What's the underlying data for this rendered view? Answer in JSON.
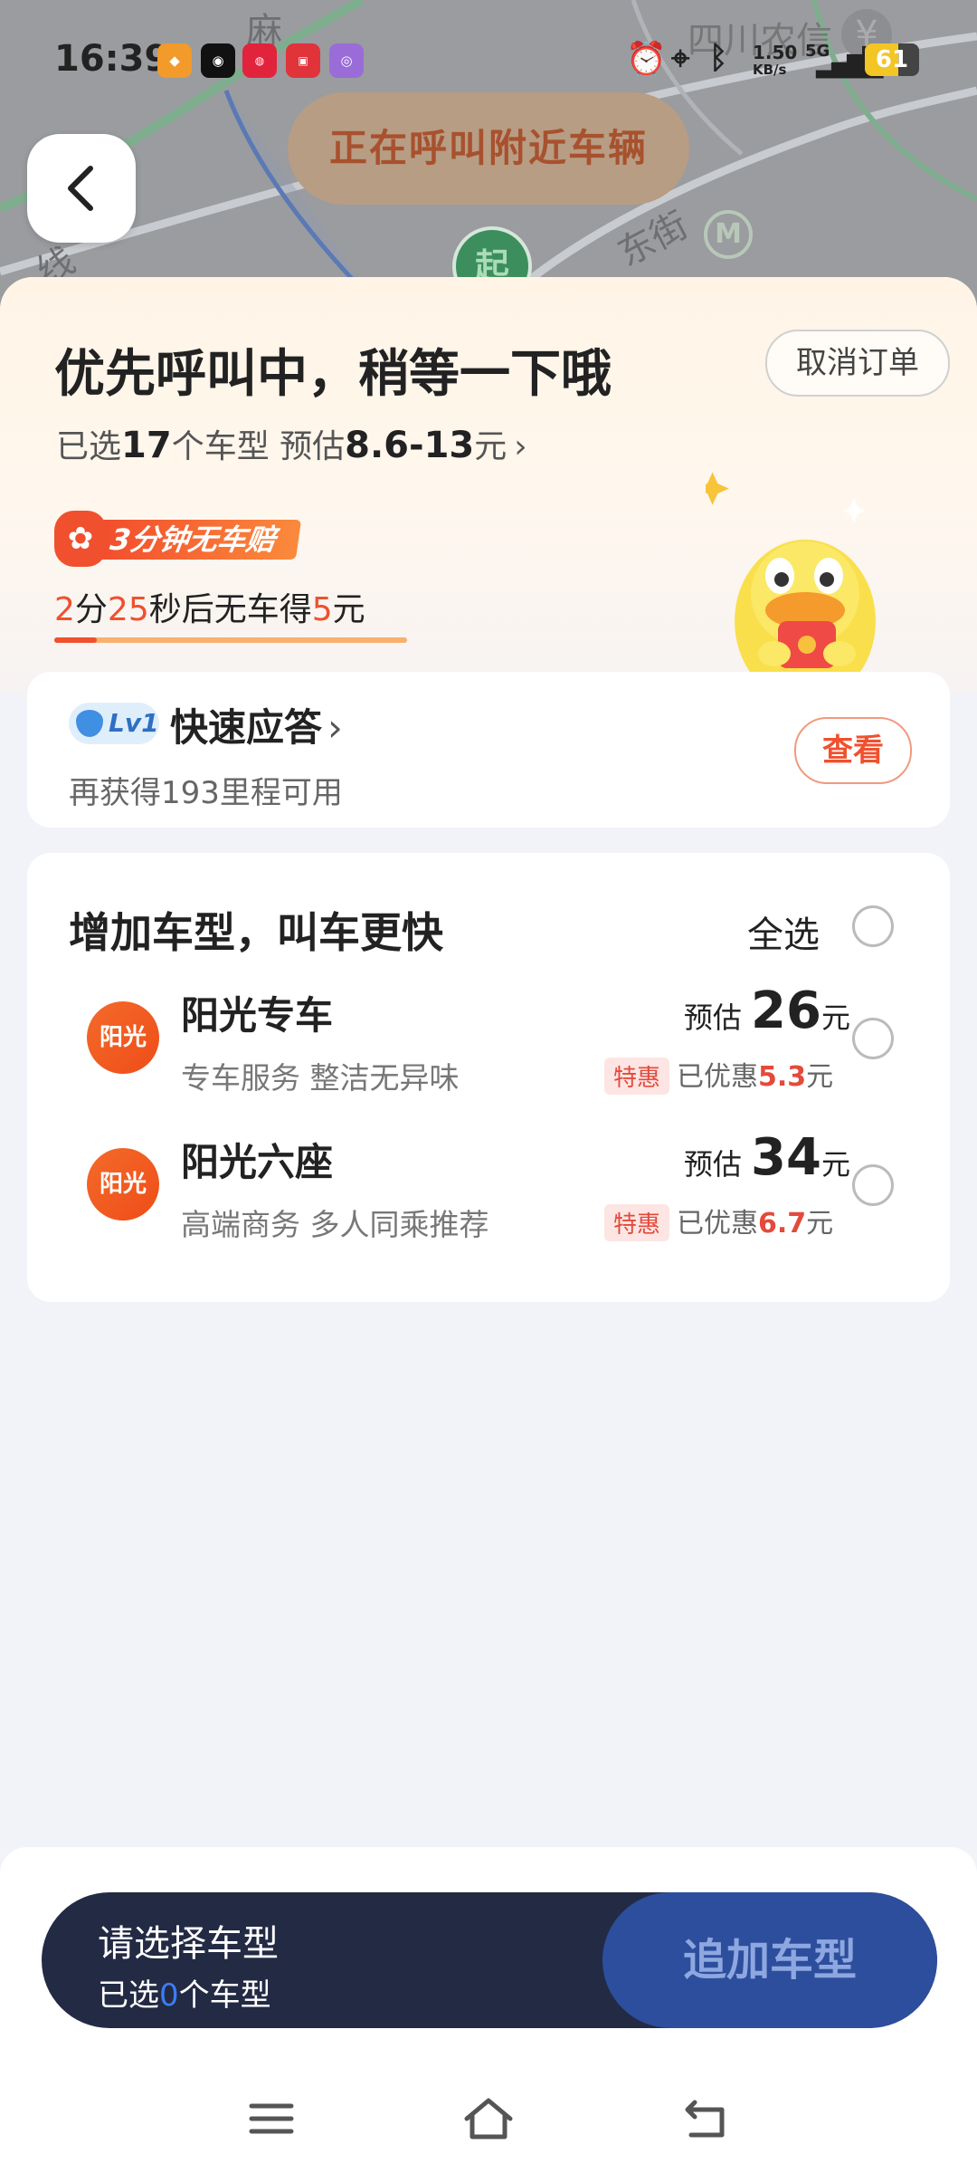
{
  "status_bar": {
    "time": "16:39",
    "net_speed": "1.50",
    "net_unit": "KB/s",
    "net_type": "5G",
    "battery": "61",
    "battery_level": 0.61
  },
  "map": {
    "labels": [
      "麻",
      "东街",
      "线"
    ],
    "bank_label": "四川农信",
    "bank_symbol": "¥",
    "start_marker": "起",
    "calling_status": "正在呼叫附近车辆"
  },
  "header": {
    "title": "优先呼叫中，稍等一下哦",
    "cancel_label": "取消订单",
    "selected_prefix": "已选",
    "selected_count": "17",
    "selected_mid": "个车型 预估",
    "price_range": "8.6-13",
    "price_unit": "元",
    "promo_badge": "3分钟无车赔",
    "countdown": {
      "min": "2",
      "min_unit": "分",
      "sec": "25",
      "sec_unit": "秒后无车得",
      "amount": "5",
      "amount_unit": "元"
    },
    "countdown_progress": 0.12
  },
  "level_card": {
    "badge": "Lv1",
    "title": "快速应答",
    "subtitle": "再获得193里程可用",
    "view_label": "查看"
  },
  "add_types": {
    "title": "增加车型，叫车更快",
    "select_all_label": "全选",
    "items": [
      {
        "logo": "阳光",
        "name": "阳光专车",
        "desc": "专车服务 整洁无异味",
        "price_prefix": "预估",
        "price": "26",
        "price_unit": "元",
        "tag": "特惠",
        "discount_prefix": "已优惠",
        "discount": "5.3",
        "discount_unit": "元"
      },
      {
        "logo": "阳光",
        "name": "阳光六座",
        "desc": "高端商务 多人同乘推荐",
        "price_prefix": "预估",
        "price": "34",
        "price_unit": "元",
        "tag": "特惠",
        "discount_prefix": "已优惠",
        "discount": "6.7",
        "discount_unit": "元"
      }
    ]
  },
  "bottom": {
    "prompt": "请选择车型",
    "selected_prefix": "已选",
    "selected_count": "0",
    "selected_suffix": "个车型",
    "add_button": "追加车型"
  },
  "colors": {
    "accent_orange": "#f0502e",
    "action_bar": "#232a44",
    "add_button": "#2c4e9c"
  }
}
